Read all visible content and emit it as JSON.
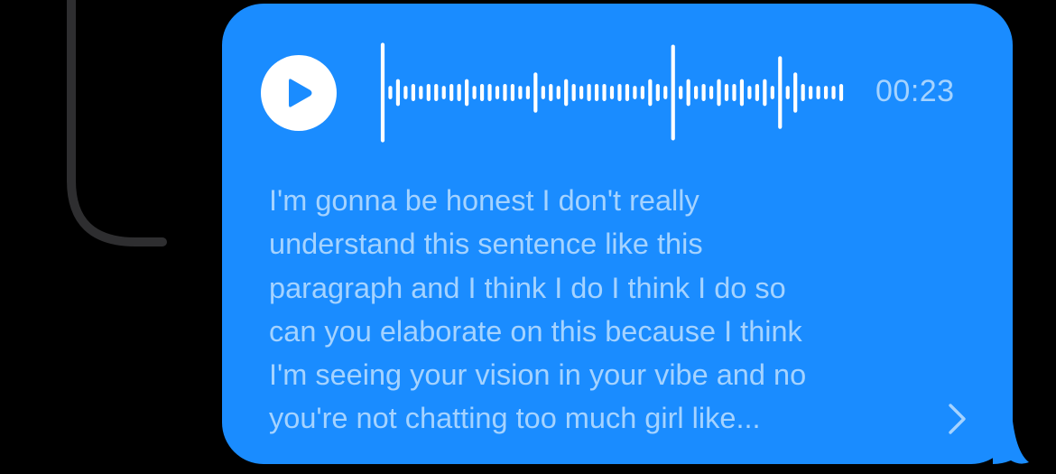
{
  "audio_message": {
    "duration": "00:23",
    "icon_play": "play-icon",
    "icon_expand": "chevron-right-icon",
    "waveform_levels": [
      1,
      0.1,
      0.24,
      0.1,
      0.14,
      0.1,
      0.14,
      0.14,
      0.1,
      0.14,
      0.14,
      0.24,
      0.1,
      0.14,
      0.14,
      0.1,
      0.14,
      0.14,
      0.1,
      0.1,
      0.38,
      0.1,
      0.14,
      0.1,
      0.24,
      0.14,
      0.1,
      0.14,
      0.14,
      0.14,
      0.1,
      0.14,
      0.14,
      0.1,
      0.1,
      0.24,
      0.14,
      0.1,
      0.96,
      0.1,
      0.24,
      0.1,
      0.14,
      0.1,
      0.24,
      0.14,
      0.14,
      0.24,
      0.1,
      0.14,
      0.24,
      0.1,
      0.72,
      0.1,
      0.38,
      0.14,
      0.1,
      0.1,
      0.1,
      0.1,
      0.14
    ]
  },
  "transcript": {
    "text": "I'm gonna be honest I don't really\nunderstand this sentence like this\nparagraph and I think I do I think I do so\ncan you elaborate on this because I think\nI'm seeing your vision in your vibe and no\nyou're not chatting too much girl like..."
  },
  "colors": {
    "background": "#000000",
    "bubble": "#1a8cff",
    "text": "#a5d3ff",
    "waveform": "#ffffff",
    "connector": "#2e2e30"
  }
}
